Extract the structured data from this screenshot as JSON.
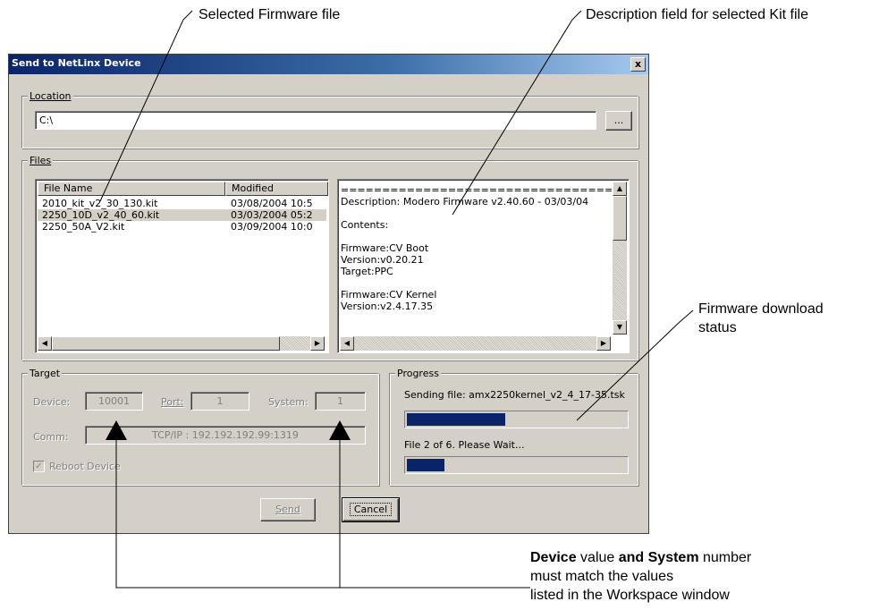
{
  "callouts": {
    "firmware_file": "Selected Firmware file",
    "description_field": "Description field for selected Kit file",
    "download_status_line1": "Firmware download",
    "download_status_line2": "status",
    "note_bold1": "Device",
    "note_text1": " value ",
    "note_bold2": "and System",
    "note_text2": " number",
    "note_line2": "must match the values",
    "note_line3": "listed in the Workspace window"
  },
  "dialog": {
    "title": "Send to NetLinx Device",
    "close_glyph": "x",
    "location": {
      "group_label": "Location",
      "path_value": "C:\\",
      "browse_label": "..."
    },
    "files": {
      "group_label": "Files",
      "columns": [
        "File Name",
        "Modified"
      ],
      "rows": [
        {
          "name": "2010_kit_v2_30_130.kit",
          "modified": "03/08/2004  10:5",
          "selected": false
        },
        {
          "name": "2250_10D_v2_40_60.kit",
          "modified": "03/03/2004  05:2",
          "selected": true
        },
        {
          "name": "2250_50A_V2.kit",
          "modified": "03/09/2004  10:0",
          "selected": false
        }
      ],
      "description_lines": [
        "==================================",
        "Description: Modero Firmware v2.40.60 - 03/03/04",
        "",
        "Contents:",
        "",
        "Firmware:CV Boot",
        "Version:v0.20.21",
        "Target:PPC",
        "",
        "Firmware:CV Kernel",
        "Version:v2.4.17.35"
      ]
    },
    "target": {
      "group_label": "Target",
      "device_label": "Device:",
      "device_value": "10001",
      "port_label": "Port:",
      "port_value": "1",
      "system_label": "System:",
      "system_value": "1",
      "comm_label": "Comm:",
      "comm_value": "TCP/IP : 192.192.192.99:1319",
      "reboot_label": "Reboot Device",
      "reboot_checked": true
    },
    "progress": {
      "group_label": "Progress",
      "file_status": "Sending file: amx2250kernel_v2_4_17-35.tsk",
      "file_progress": 0.45,
      "overall_status": "File 2 of 6. Please Wait...",
      "overall_progress": 0.17
    },
    "buttons": {
      "send": "Send",
      "cancel": "Cancel"
    }
  }
}
